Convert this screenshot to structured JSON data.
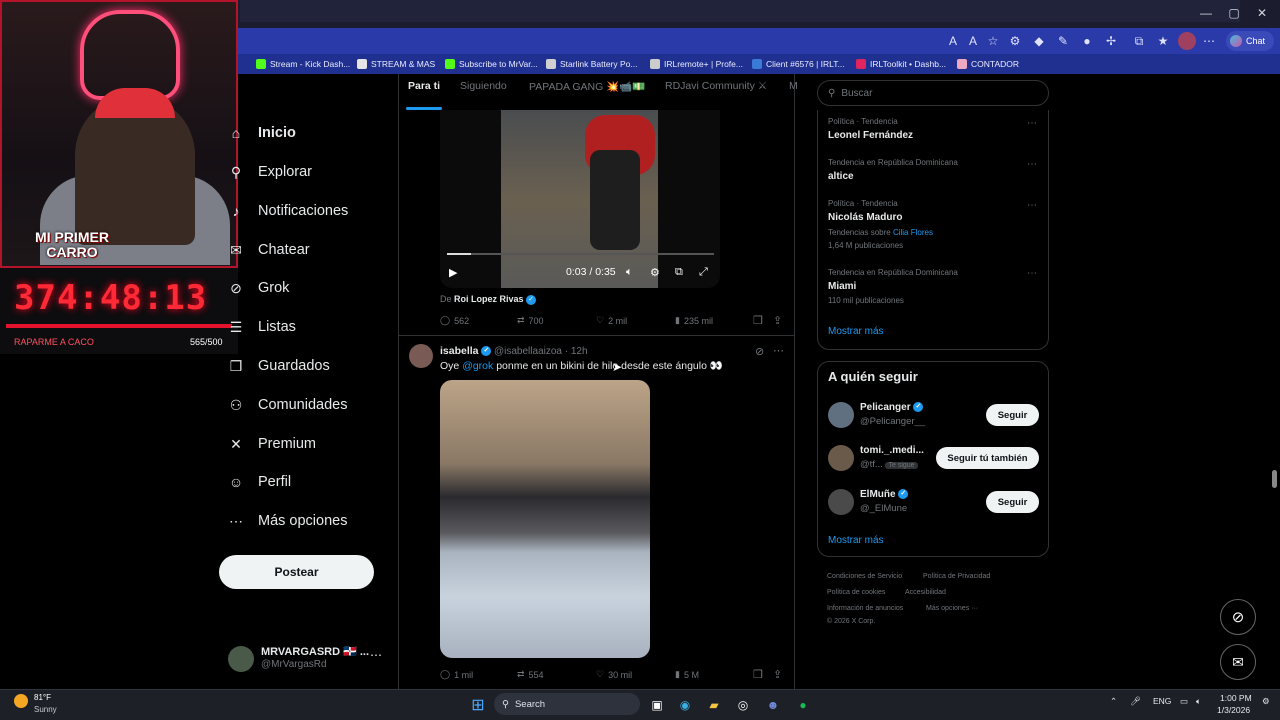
{
  "browser": {
    "bookmarks": [
      {
        "label": "Stream - Kick Dash...",
        "color": "#53fc18"
      },
      {
        "label": "STREAM & MAS",
        "color": "#e6e6e6"
      },
      {
        "label": "Subscribe to MrVar...",
        "color": "#53fc18"
      },
      {
        "label": "Starlink Battery Po...",
        "color": "#d0d0d0"
      },
      {
        "label": "IRLremote+ | Profe...",
        "color": "#cccccc"
      },
      {
        "label": "Client #6576 | IRLT...",
        "color": "#3a7bd5"
      },
      {
        "label": "IRLToolkit • Dashb...",
        "color": "#e0245e"
      },
      {
        "label": "CONTADOR",
        "color": "#f0a8c0"
      }
    ],
    "copilot_label": "Chat"
  },
  "overlay": {
    "banner": "MI PRIMER CARRO",
    "timer": "374:48:13",
    "label": "RAPARME A CACO",
    "count": "565/500"
  },
  "nav": {
    "items": [
      {
        "label": "Inicio",
        "icon": "home-icon",
        "glyph": "⌂"
      },
      {
        "label": "Explorar",
        "icon": "search-icon",
        "glyph": "⚲"
      },
      {
        "label": "Notificaciones",
        "icon": "bell-icon",
        "glyph": "♪"
      },
      {
        "label": "Chatear",
        "icon": "chat-icon",
        "glyph": "✉"
      },
      {
        "label": "Grok",
        "icon": "grok-icon",
        "glyph": "⊘"
      },
      {
        "label": "Listas",
        "icon": "list-icon",
        "glyph": "☰"
      },
      {
        "label": "Guardados",
        "icon": "bookmark-icon",
        "glyph": "❒"
      },
      {
        "label": "Comunidades",
        "icon": "communities-icon",
        "glyph": "⚇"
      },
      {
        "label": "Premium",
        "icon": "x-icon",
        "glyph": "✕"
      },
      {
        "label": "Perfil",
        "icon": "profile-icon",
        "glyph": "☺"
      },
      {
        "label": "Más opciones",
        "icon": "more-icon",
        "glyph": "⋯"
      }
    ],
    "post_button": "Postear",
    "account": {
      "name": "MRVARGASRD 🇩🇴 ...",
      "handle": "@MrVargasRd"
    }
  },
  "tabs": [
    "Para ti",
    "Siguiendo",
    "PAPADA GANG 💥📹💵",
    "RDJavi Community ⚔",
    "M"
  ],
  "video_post": {
    "time": "0:03 / 0:35",
    "progress": 0.09,
    "attribution_prefix": "De",
    "attribution_name": "Roi Lopez Rivas",
    "replies": "562",
    "reposts": "700",
    "likes": "2 mil",
    "views": "235 mil"
  },
  "tweet": {
    "name": "isabella",
    "handle": "@isabellaaizoa · 12h",
    "text_before": "Oye ",
    "mention": "@grok",
    "text_after": " ponme en un bikini de hilo desde este ángulo 👀",
    "replies": "1 mil",
    "reposts": "554",
    "likes": "30 mil",
    "views": "5 M"
  },
  "sidebar": {
    "search_placeholder": "Buscar",
    "trends": [
      {
        "meta": "Política · Tendencia",
        "name": "Leonel Fernández"
      },
      {
        "meta": "Tendencia en República Dominicana",
        "name": "altice"
      },
      {
        "meta": "Política · Tendencia",
        "name": "Nicolás Maduro",
        "sub_prefix": "Tendencias sobre ",
        "sub_link": "Cilia Flores",
        "count": "1,64 M publicaciones"
      },
      {
        "meta": "Tendencia en República Dominicana",
        "name": "Miami",
        "count": "110 mil publicaciones"
      }
    ],
    "show_more": "Mostrar más",
    "who_to_follow_title": "A quién seguir",
    "follow": [
      {
        "name": "Pelicanger",
        "handle": "@Pelicanger__",
        "button": "Seguir"
      },
      {
        "name": "tomi._.medi...",
        "handle": "@tf...",
        "badge": "Te sigue",
        "button": "Seguir tú también"
      },
      {
        "name": "ElMuñe",
        "handle": "@_ElMune",
        "button": "Seguir"
      }
    ],
    "follow_more": "Mostrar más",
    "footer": [
      "Condiciones de Servicio",
      "Política de Privacidad",
      "Política de cookies",
      "Accesibilidad",
      "Información de anuncios",
      "Más opciones ···",
      "© 2026 X Corp."
    ]
  },
  "taskbar": {
    "weather_temp": "81°F",
    "weather_desc": "Sunny",
    "search": "Search",
    "lang": "ENG",
    "time": "1:00 PM",
    "date": "1/3/2026"
  }
}
